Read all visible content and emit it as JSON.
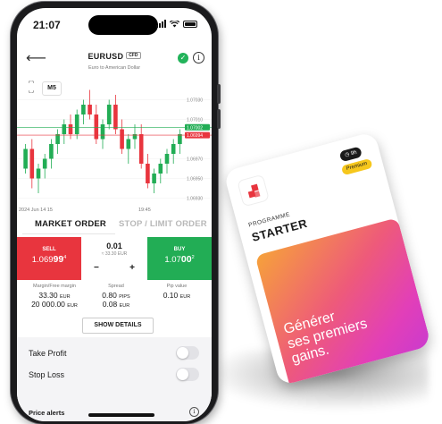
{
  "status_bar": {
    "time": "21:07"
  },
  "header": {
    "symbol": "EURUSD",
    "badge": "CFD",
    "subtitle": "Euro to American Dollar"
  },
  "chart": {
    "timeframe": "M5",
    "price_levels": [
      "1.07030",
      "1.07010",
      "1.07002",
      "1.06994",
      "1.06970",
      "1.06950",
      "1.06930"
    ],
    "time_labels": [
      "2024 Jun 14 15",
      "19:45"
    ],
    "bid_price": "1.07002",
    "ask_price": "1.06994"
  },
  "chart_data": {
    "type": "candlestick",
    "ylim": [
      1.06925,
      1.07045
    ],
    "x_labels": [
      "2024 Jun 14 15",
      "19:45"
    ],
    "candles": [
      [
        1.0696,
        1.06985,
        1.06955,
        1.0698
      ],
      [
        1.0698,
        1.0699,
        1.0694,
        1.0695
      ],
      [
        1.0695,
        1.06965,
        1.06935,
        1.0696
      ],
      [
        1.0696,
        1.06975,
        1.0695,
        1.0697
      ],
      [
        1.0697,
        1.0699,
        1.0696,
        1.06985
      ],
      [
        1.06985,
        1.07,
        1.06975,
        1.06995
      ],
      [
        1.06995,
        1.0701,
        1.06985,
        1.07005
      ],
      [
        1.07005,
        1.07015,
        1.0699,
        1.06995
      ],
      [
        1.06995,
        1.0702,
        1.0699,
        1.07015
      ],
      [
        1.07015,
        1.0703,
        1.07005,
        1.07025
      ],
      [
        1.07025,
        1.0704,
        1.0701,
        1.07015
      ],
      [
        1.07015,
        1.07025,
        1.06985,
        1.0699
      ],
      [
        1.0699,
        1.0701,
        1.0698,
        1.07005
      ],
      [
        1.07005,
        1.0703,
        1.07,
        1.07025
      ],
      [
        1.07025,
        1.07035,
        1.06995,
        1.07
      ],
      [
        1.07,
        1.0701,
        1.06975,
        1.0698
      ],
      [
        1.0698,
        1.06995,
        1.06965,
        1.0699
      ],
      [
        1.0699,
        1.07005,
        1.0698,
        1.06995
      ],
      [
        1.06995,
        1.07005,
        1.0696,
        1.06965
      ],
      [
        1.06965,
        1.06975,
        1.0694,
        1.06945
      ],
      [
        1.06945,
        1.0696,
        1.06935,
        1.06955
      ],
      [
        1.06955,
        1.0697,
        1.06945,
        1.06965
      ],
      [
        1.06965,
        1.0698,
        1.06955,
        1.06975
      ],
      [
        1.06975,
        1.0699,
        1.06965,
        1.06985
      ],
      [
        1.06985,
        1.07,
        1.06975,
        1.06995
      ]
    ]
  },
  "order_tabs": {
    "market": "MARKET ORDER",
    "stop_limit": "STOP / LIMIT ORDER"
  },
  "trade": {
    "sell_label": "SELL",
    "sell_price_head": "1.069",
    "sell_price_big": "99",
    "sell_price_sup": "4",
    "buy_label": "BUY",
    "buy_price_head": "1.07",
    "buy_price_big": "00",
    "buy_price_sup": "2",
    "quantity": "0.01",
    "quantity_eur": "≈ 33.30 EUR",
    "minus": "−",
    "plus": "+"
  },
  "stats": {
    "margin_label": "Margin/Free margin",
    "margin_value": "33.30",
    "margin_unit": "EUR",
    "free_margin_value": "20 000.00",
    "free_margin_unit": "EUR",
    "spread_label": "Spread",
    "spread_value": "0.80",
    "spread_unit": "PIPS",
    "spread_eur_value": "0.08",
    "spread_eur_unit": "EUR",
    "pip_label": "Pip value",
    "pip_value": "0.10",
    "pip_unit": "EUR"
  },
  "details_button": "SHOW DETAILS",
  "settings": {
    "take_profit": "Take Profit",
    "stop_loss": "Stop Loss",
    "price_alerts": "Price alerts"
  },
  "promo": {
    "timer": "9h",
    "badge": "Premium",
    "programme": "PROGRAMME",
    "name": "STARTER",
    "slogan_1": "Générer",
    "slogan_2": "ses premiers",
    "slogan_3": "gains."
  },
  "colors": {
    "sell": "#e8353e",
    "buy": "#22ad55",
    "premium": "#f6c71c"
  }
}
